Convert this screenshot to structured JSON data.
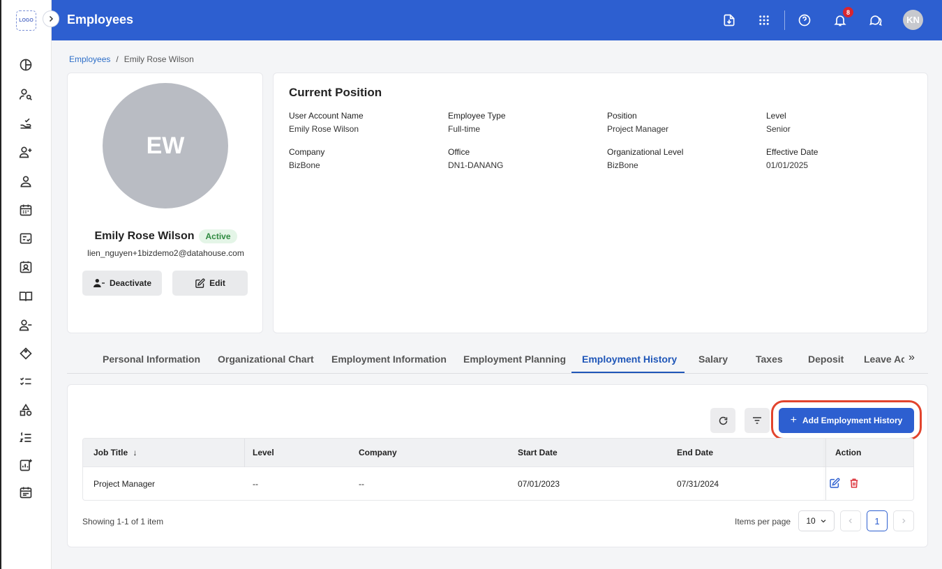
{
  "app": {
    "logo_text": "LOGO",
    "page_title": "Employees",
    "notification_count": "8",
    "user_initials": "KN"
  },
  "breadcrumb": {
    "root": "Employees",
    "separator": "/",
    "current": "Emily Rose Wilson"
  },
  "profile": {
    "initials": "EW",
    "name": "Emily Rose Wilson",
    "status": "Active",
    "email": "lien_nguyen+1bizdemo2@datahouse.com",
    "deactivate_label": "Deactivate",
    "edit_label": "Edit"
  },
  "current_position": {
    "title": "Current Position",
    "fields": [
      {
        "label": "User Account Name",
        "value": "Emily Rose Wilson"
      },
      {
        "label": "Employee Type",
        "value": "Full-time"
      },
      {
        "label": "Position",
        "value": "Project Manager"
      },
      {
        "label": "Level",
        "value": "Senior"
      },
      {
        "label": "Company",
        "value": "BizBone"
      },
      {
        "label": "Office",
        "value": "DN1-DANANG"
      },
      {
        "label": "Organizational Level",
        "value": "BizBone"
      },
      {
        "label": "Effective Date",
        "value": "01/01/2025"
      }
    ]
  },
  "tabs": [
    {
      "label": "Personal Information"
    },
    {
      "label": "Organizational Chart"
    },
    {
      "label": "Employment Information"
    },
    {
      "label": "Employment Planning"
    },
    {
      "label": "Employment History",
      "active": true
    },
    {
      "label": "Salary"
    },
    {
      "label": "Taxes"
    },
    {
      "label": "Deposit"
    },
    {
      "label": "Leave Ac"
    }
  ],
  "history": {
    "add_button_label": "Add Employment History",
    "columns": [
      "Job Title",
      "Level",
      "Company",
      "Start Date",
      "End Date",
      "Action"
    ],
    "rows": [
      {
        "job_title": "Project Manager",
        "level": "--",
        "company": "--",
        "start_date": "07/01/2023",
        "end_date": "07/31/2024"
      }
    ],
    "showing_text": "Showing 1-1 of 1 item",
    "items_per_page_label": "Items per page",
    "items_per_page_value": "10",
    "current_page": "1"
  },
  "colors": {
    "primary": "#2d5fd0",
    "active_badge_bg": "#e4f5e7",
    "active_badge_text": "#2f8a40",
    "delete_icon": "#d9252e",
    "highlight_outline": "#e2442d"
  }
}
